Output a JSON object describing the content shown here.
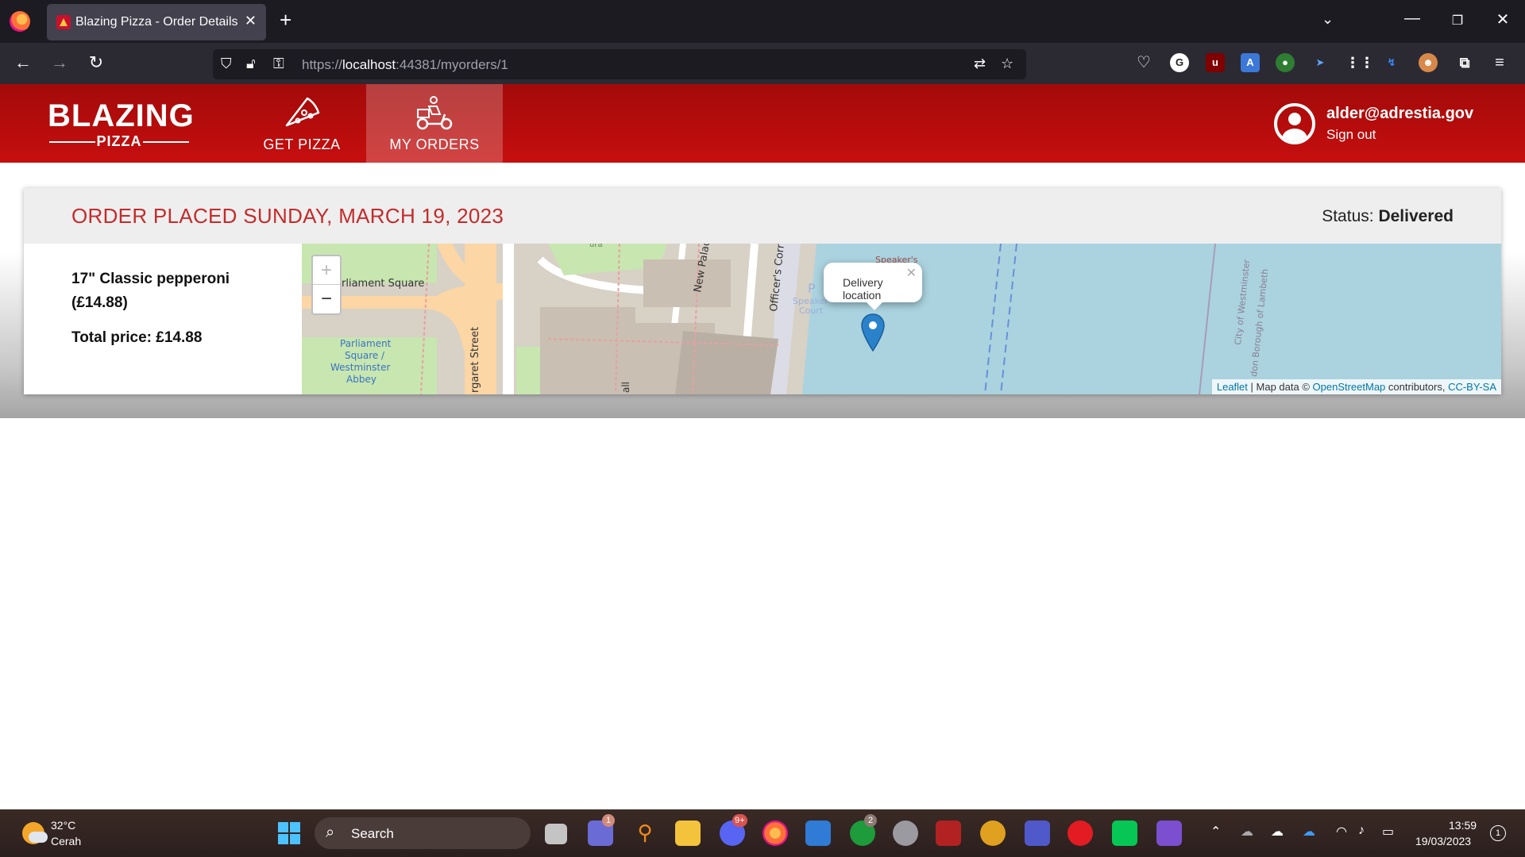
{
  "browser": {
    "tab_title": "Blazing Pizza - Order Details",
    "url_scheme": "https://",
    "url_host": "localhost",
    "url_path": ":44381/myorders/1"
  },
  "app": {
    "brand_main": "BLAZING",
    "brand_sub": "PIZZA",
    "nav": [
      {
        "label": "GET PIZZA",
        "active": false
      },
      {
        "label": "MY ORDERS",
        "active": true
      }
    ],
    "user_email": "alder@adrestia.gov",
    "sign_out": "Sign out",
    "accent_color": "#c60e0e"
  },
  "order": {
    "title": "ORDER PLACED SUNDAY, MARCH 19, 2023",
    "status_label": "Status:",
    "status_value": "Delivered",
    "item_name": "17\" Classic pepperoni",
    "item_price": "(£14.88)",
    "total": "Total price: £14.88"
  },
  "map": {
    "labels": [
      "rliament Square",
      "Parliament",
      "Square /",
      "Westminster",
      "Abbey",
      "rgaret Street",
      "New Palac",
      "Officer's Corr",
      "P",
      "Speaker",
      "Court",
      "Speaker's",
      "City of Westminster",
      "don Borough of Lambeth",
      "all",
      "ura"
    ],
    "popup_text": "Delivery location",
    "zoom_in": "+",
    "zoom_out": "−",
    "attr_leaflet": "Leaflet",
    "attr_mid": " | Map data © ",
    "attr_osm": "OpenStreetMap",
    "attr_contrib": " contributors, ",
    "attr_license": "CC-BY-SA"
  },
  "taskbar": {
    "weather_temp": "32°C",
    "weather_desc": "Cerah",
    "search_label": "Search",
    "badges": [
      "1",
      "9+",
      "2"
    ],
    "clock_time": "13:59",
    "clock_date": "19/03/2023",
    "notifications": "1"
  }
}
